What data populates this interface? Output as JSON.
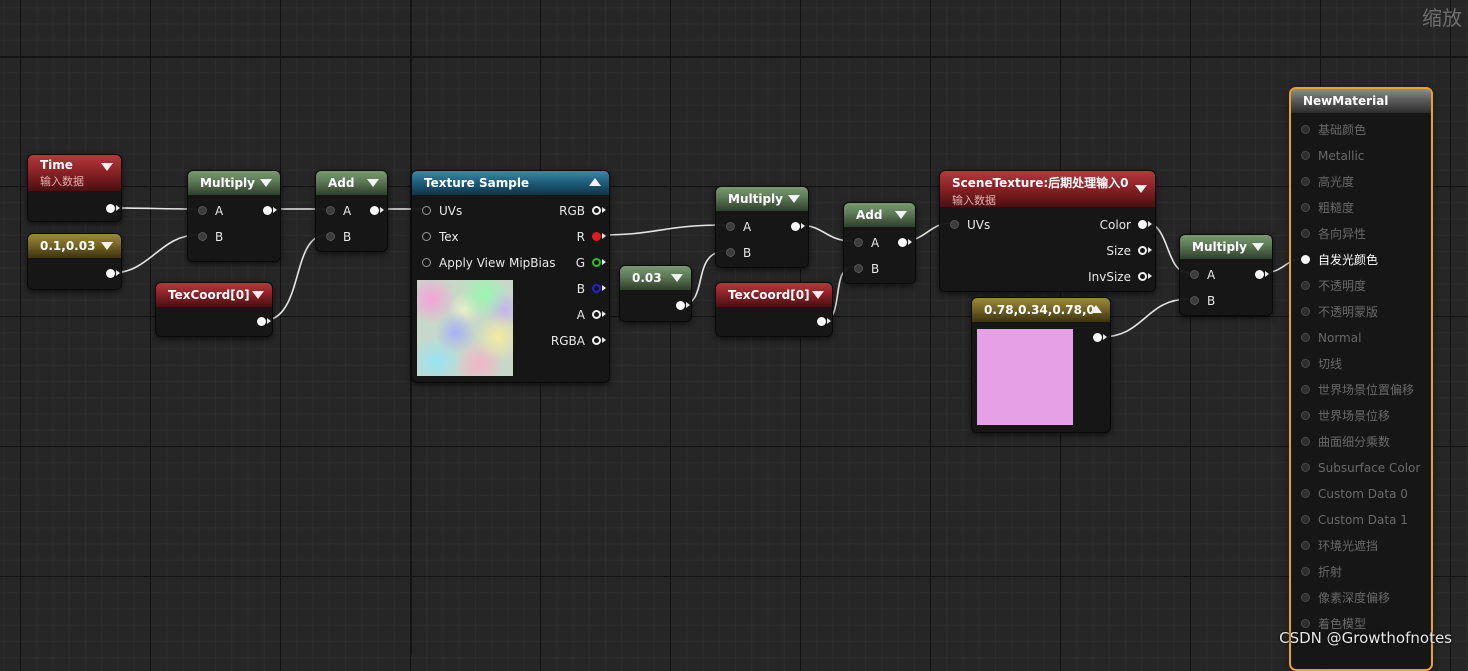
{
  "overlay": {
    "zoom_label": "缩放",
    "watermark": "CSDN @Growthofnotes"
  },
  "nodes": {
    "time": {
      "title": "Time",
      "subtitle": "输入数据"
    },
    "const2": {
      "title": "0.1,0.03"
    },
    "multiply1": {
      "title": "Multiply",
      "pin_a": "A",
      "pin_b": "B"
    },
    "add1": {
      "title": "Add",
      "pin_a": "A",
      "pin_b": "B"
    },
    "texcoord1": {
      "title": "TexCoord[0]"
    },
    "texture_sample": {
      "title": "Texture Sample",
      "in_uvs": "UVs",
      "in_tex": "Tex",
      "in_mip": "Apply View MipBias",
      "out_rgb": "RGB",
      "out_r": "R",
      "out_g": "G",
      "out_b": "B",
      "out_a": "A",
      "out_rgba": "RGBA"
    },
    "const003": {
      "title": "0.03"
    },
    "multiply2": {
      "title": "Multiply",
      "pin_a": "A",
      "pin_b": "B"
    },
    "texcoord2": {
      "title": "TexCoord[0]"
    },
    "add2": {
      "title": "Add",
      "pin_a": "A",
      "pin_b": "B"
    },
    "scene_texture": {
      "title": "SceneTexture:后期处理输入0",
      "subtitle": "输入数据",
      "in_uvs": "UVs",
      "out_color": "Color",
      "out_size": "Size",
      "out_invsize": "InvSize"
    },
    "color_const": {
      "title": "0.78,0.34,0.78,0",
      "swatch_color": "#e6a0e6"
    },
    "multiply3": {
      "title": "Multiply",
      "pin_a": "A",
      "pin_b": "B"
    },
    "result": {
      "title": "NewMaterial",
      "pins": [
        "基础颜色",
        "Metallic",
        "高光度",
        "粗糙度",
        "各向异性",
        "自发光颜色",
        "不透明度",
        "不透明蒙版",
        "Normal",
        "切线",
        "世界场景位置偏移",
        "世界场景位移",
        "曲面细分乘数",
        "Subsurface Color",
        "Custom Data 0",
        "Custom Data 1",
        "环境光遮挡",
        "折射",
        "像素深度偏移",
        "着色模型"
      ],
      "active_pin": "自发光颜色",
      "selection_color": "#f0a020"
    }
  },
  "colors": {
    "wire": "#e6e6e6",
    "pin_r": "#e21a1a",
    "pin_g": "#1fc81f",
    "pin_b": "#2222dd"
  }
}
